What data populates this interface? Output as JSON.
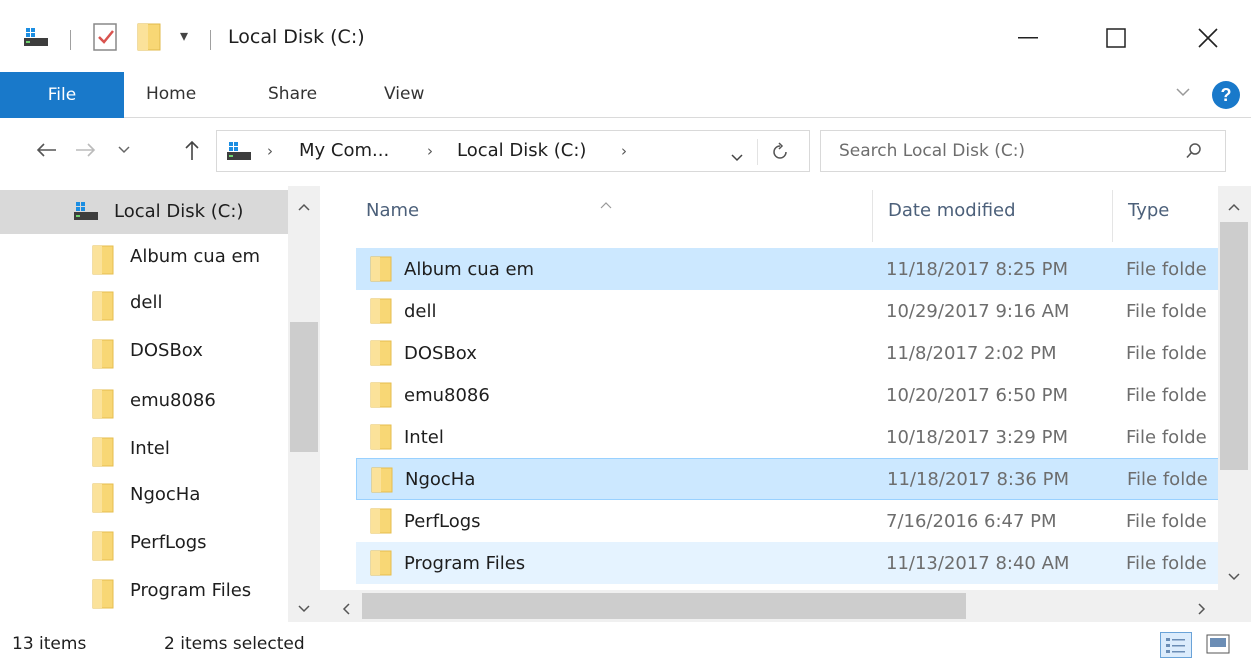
{
  "window": {
    "title": "Local Disk (C:)",
    "quick_access_overflow": "▾"
  },
  "ribbon": {
    "tabs": [
      "File",
      "Home",
      "Share",
      "View"
    ]
  },
  "address": {
    "crumbs": [
      "My Com...",
      "Local Disk (C:)"
    ],
    "search_placeholder": "Search Local Disk (C:)"
  },
  "nav_pane": {
    "root": "Local Disk (C:)",
    "items": [
      "Album cua em",
      "dell",
      "DOSBox",
      "emu8086",
      "Intel",
      "NgocHa",
      "PerfLogs",
      "Program Files"
    ]
  },
  "columns": {
    "name": "Name",
    "date": "Date modified",
    "type": "Type"
  },
  "files": [
    {
      "name": "Album cua em",
      "date": "11/18/2017 8:25 PM",
      "type": "File folde",
      "state": "selected"
    },
    {
      "name": "dell",
      "date": "10/29/2017 9:16 AM",
      "type": "File folde",
      "state": "normal"
    },
    {
      "name": "DOSBox",
      "date": "11/8/2017 2:02 PM",
      "type": "File folde",
      "state": "normal"
    },
    {
      "name": "emu8086",
      "date": "10/20/2017 6:50 PM",
      "type": "File folde",
      "state": "normal"
    },
    {
      "name": "Intel",
      "date": "10/18/2017 3:29 PM",
      "type": "File folde",
      "state": "normal"
    },
    {
      "name": "NgocHa",
      "date": "11/18/2017 8:36 PM",
      "type": "File folde",
      "state": "selected-focused"
    },
    {
      "name": "PerfLogs",
      "date": "7/16/2016 6:47 PM",
      "type": "File folde",
      "state": "normal"
    },
    {
      "name": "Program Files",
      "date": "11/13/2017 8:40 AM",
      "type": "File folde",
      "state": "hover"
    }
  ],
  "status": {
    "item_count": "13 items",
    "selected_count": "2 items selected"
  },
  "colors": {
    "accent": "#1979ca",
    "selection": "#cce8ff",
    "hover": "#e5f3ff",
    "folder": "#f8d775"
  }
}
